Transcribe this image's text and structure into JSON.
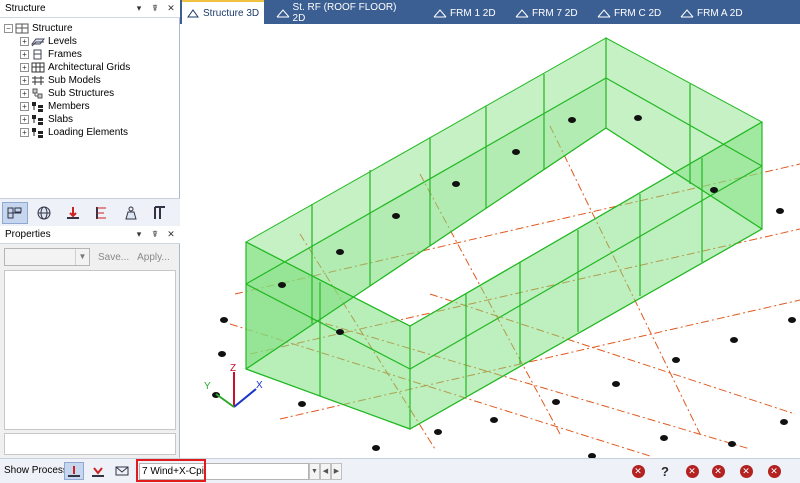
{
  "structure_panel": {
    "title": "Structure",
    "pin": "▾ ⨯",
    "tree": {
      "root": "Structure",
      "items": [
        {
          "label": "Levels",
          "icon": "levels-icon"
        },
        {
          "label": "Frames",
          "icon": "frames-icon"
        },
        {
          "label": "Architectural Grids",
          "icon": "grid-icon"
        },
        {
          "label": "Sub Models",
          "icon": "submodels-icon"
        },
        {
          "label": "Sub Structures",
          "icon": "substructures-icon"
        },
        {
          "label": "Members",
          "icon": "members-icon"
        },
        {
          "label": "Slabs",
          "icon": "slabs-icon"
        },
        {
          "label": "Loading Elements",
          "icon": "loading-icon"
        }
      ]
    }
  },
  "properties_panel": {
    "title": "Properties",
    "save_label": "Save...",
    "apply_label": "Apply..."
  },
  "tabs": [
    {
      "label": "Structure 3D",
      "active": true
    },
    {
      "label": "St. RF (ROOF FLOOR) 2D",
      "active": false
    },
    {
      "label": "FRM 1 2D",
      "active": false
    },
    {
      "label": "FRM 7 2D",
      "active": false
    },
    {
      "label": "FRM C 2D",
      "active": false
    },
    {
      "label": "FRM A 2D",
      "active": false
    }
  ],
  "axes": {
    "x": "X",
    "y": "Y",
    "z": "Z"
  },
  "status_bar": {
    "show_process_label": "Show Process",
    "load_case": "7 Wind+X-Cpi"
  },
  "colors": {
    "accent_tab": "#3c5f93",
    "wall_fill": "#7ee07e",
    "wall_edge": "#22b822",
    "gridline": "#e05a1e",
    "highlight": "#e01c1c"
  }
}
